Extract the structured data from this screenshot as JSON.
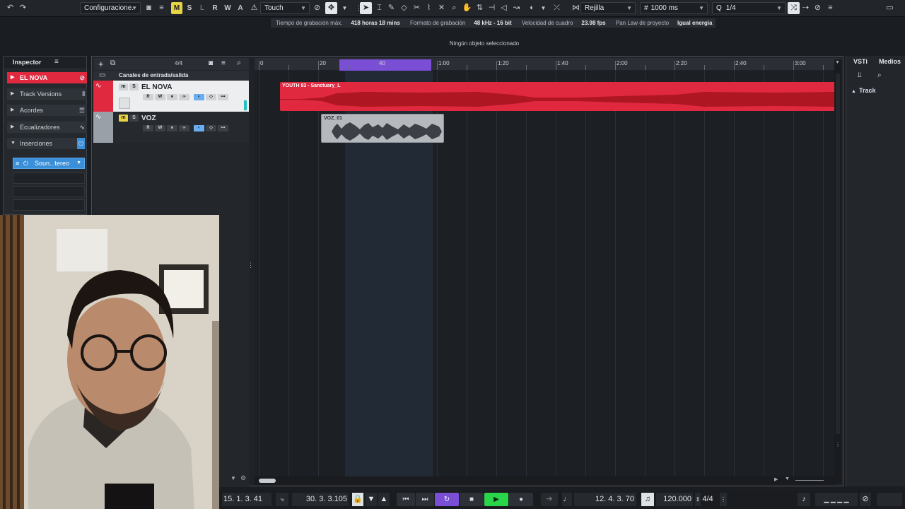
{
  "toolbar": {
    "config_label": "Configuracione.",
    "letters": [
      "M",
      "S",
      "L",
      "R",
      "W",
      "A"
    ],
    "automation_mode": "Touch",
    "snap_type": "Rejilla",
    "grid_value": "1000 ms",
    "quantize": "1/4"
  },
  "status": {
    "rec_time_label": "Tiempo de grabación máx.",
    "rec_time_value": "418 horas 18 mins",
    "format_label": "Formato de grabación",
    "format_value": "48 kHz - 16 bit",
    "framerate_label": "Velocidad de cuadro",
    "framerate_value": "23.98 fps",
    "panlaw_label": "Pan Law de proyecto",
    "panlaw_value": "Igual energía",
    "selection_info": "Ningún objeto seleccionado"
  },
  "inspector": {
    "tab_label": "Inspector",
    "track_name": "EL NOVA",
    "sections": [
      "Track Versions",
      "Acordes",
      "Ecualizadores",
      "Inserciones"
    ],
    "insert_name": "Soun...tereo"
  },
  "project": {
    "time_signature": "4/4",
    "folder_name": "Canales de entrada/salida",
    "ruler_labels": [
      "0",
      "20",
      "40",
      "1:00",
      "1:20",
      "1:40",
      "2:00",
      "2:20",
      "2:40",
      "3:00"
    ],
    "tracks": [
      {
        "name": "EL NOVA",
        "color": "#e0283f"
      },
      {
        "name": "VOZ",
        "color": "#9aa0a8"
      }
    ],
    "clips": [
      {
        "name": "YOUTH 83 - Sanctuary_L",
        "color": "#e0283f"
      },
      {
        "name": "VOZ_01",
        "color": "#b5b9be"
      }
    ]
  },
  "right_panel": {
    "tab_vsti": "VSTi",
    "tab_media": "Medios",
    "track_label": "Track"
  },
  "transport": {
    "left_locator": "15. 1. 3. 41",
    "right_locator": "30. 3. 3.105",
    "position": "12. 4. 3. 70",
    "tempo": "120.000",
    "signature": "4/4"
  },
  "colors": {
    "accent_red": "#e0283f",
    "loop_purple": "#7a4fd6",
    "play_green": "#29d64a",
    "solo_yellow": "#e8d245"
  }
}
